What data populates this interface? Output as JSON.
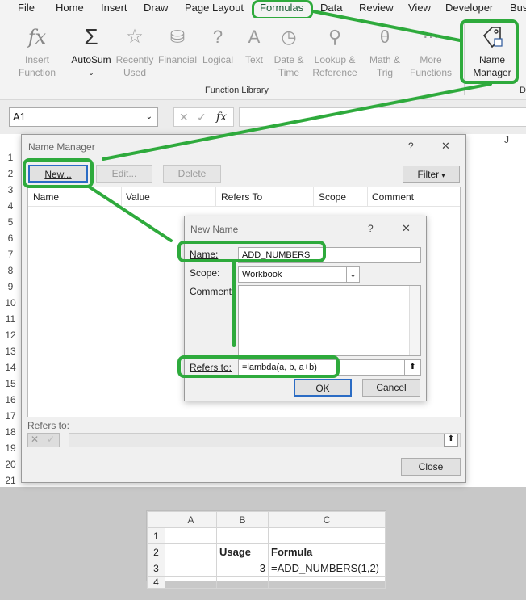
{
  "menu": [
    "File",
    "Home",
    "Insert",
    "Draw",
    "Page Layout",
    "Formulas",
    "Data",
    "Review",
    "View",
    "Developer",
    "Bus"
  ],
  "ribbon": {
    "insert_function": "Insert Function",
    "autosum": "AutoSum",
    "recently_used": "Recently Used",
    "financial": "Financial",
    "logical": "Logical",
    "text": "Text",
    "date_time": "Date & Time",
    "lookup": "Lookup & Reference",
    "math": "Math & Trig",
    "more": "More Functions",
    "name_manager_line1": "Name",
    "name_manager_line2": "Manager",
    "group_label": "Function Library",
    "group_label_d": "D"
  },
  "formula_bar": {
    "namebox": "A1",
    "fx": "fx"
  },
  "rows": [
    "1",
    "2",
    "3",
    "4",
    "5",
    "6",
    "7",
    "8",
    "9",
    "10",
    "11",
    "12",
    "13",
    "14",
    "15",
    "16",
    "17",
    "18",
    "19",
    "20",
    "21"
  ],
  "col_j": "J",
  "name_manager": {
    "title": "Name Manager",
    "help": "?",
    "close": "✕",
    "new_btn": "New...",
    "edit_btn": "Edit...",
    "delete_btn": "Delete",
    "filter_btn": "Filter",
    "columns": [
      "Name",
      "Value",
      "Refers To",
      "Scope",
      "Comment"
    ],
    "refers_to_label": "Refers to:",
    "close_btn": "Close"
  },
  "new_name": {
    "title": "New Name",
    "help": "?",
    "close": "✕",
    "name_label": "Name:",
    "name_value": "ADD_NUMBERS",
    "scope_label": "Scope:",
    "scope_value": "Workbook",
    "comment_label": "Comment:",
    "refers_label": "Refers to:",
    "refers_value": "=lambda(a, b, a+b)",
    "ok": "OK",
    "cancel": "Cancel"
  },
  "sheet2": {
    "cols": [
      "",
      "A",
      "B",
      "C"
    ],
    "rows": [
      [
        "1",
        "",
        "",
        ""
      ],
      [
        "2",
        "",
        "Usage",
        "Formula"
      ],
      [
        "3",
        "",
        "3",
        "=ADD_NUMBERS(1,2)"
      ],
      [
        "4",
        "",
        "",
        ""
      ]
    ]
  },
  "colors": {
    "highlight": "#2eaa3c",
    "accent": "#217346"
  }
}
